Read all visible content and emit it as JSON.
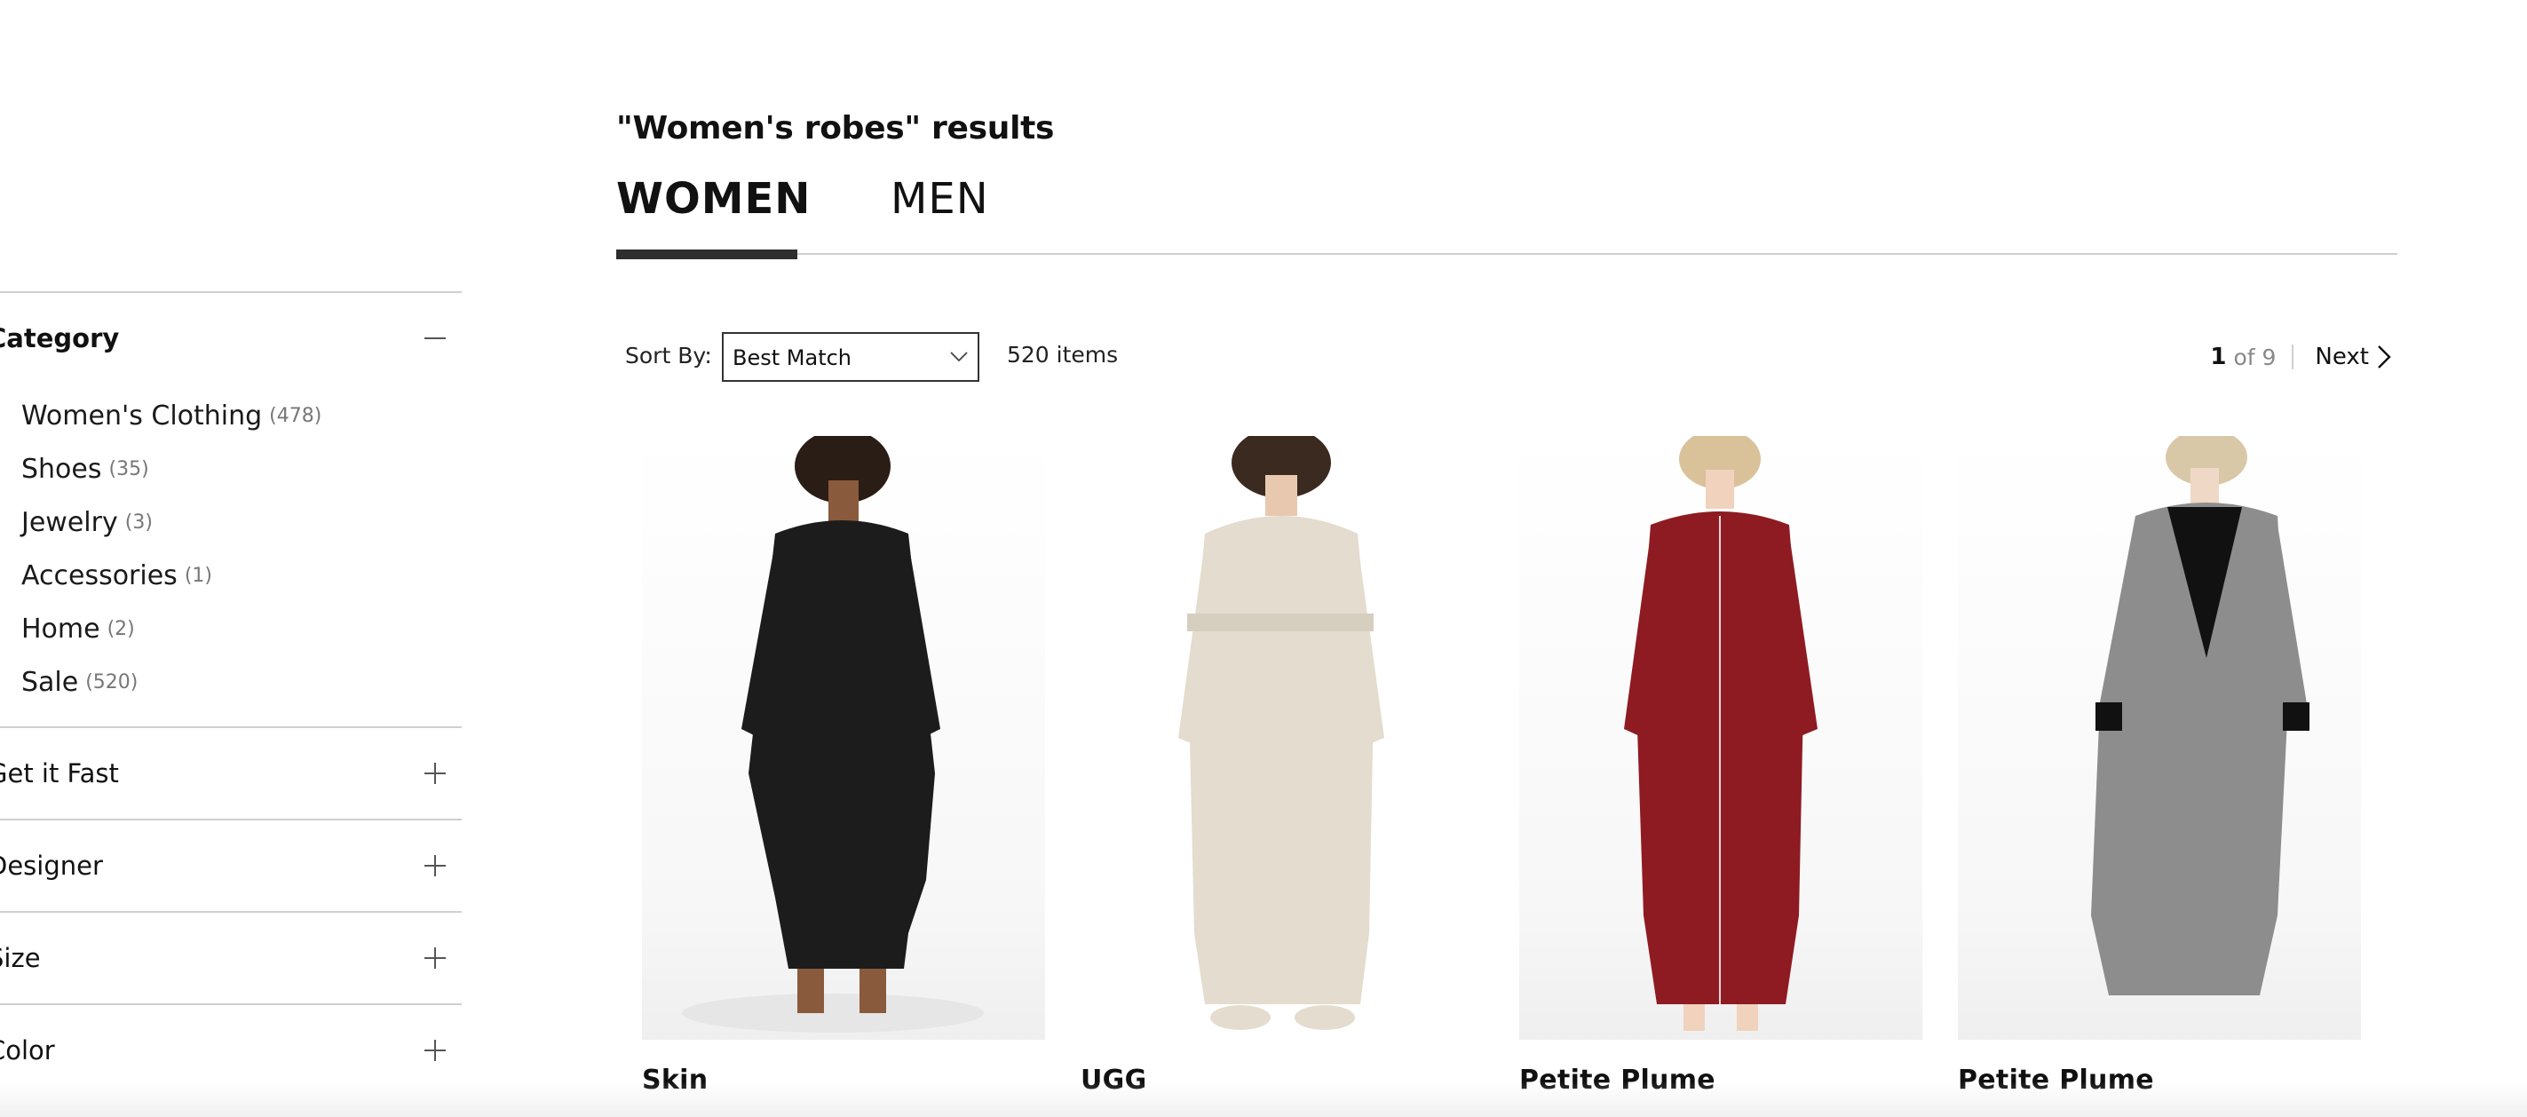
{
  "search": {
    "results_title": "\"Women's robes\" results"
  },
  "tabs": [
    {
      "label": "WOMEN",
      "active": true
    },
    {
      "label": "MEN",
      "active": false
    }
  ],
  "sort": {
    "label": "Sort By:",
    "selected": "Best Match"
  },
  "item_count": "520 items",
  "pagination": {
    "current": "1",
    "of_text": "of 9",
    "next_label": "Next"
  },
  "sidebar": {
    "category": {
      "title": "Category",
      "items": [
        {
          "label": "Women's Clothing",
          "count": "(478)"
        },
        {
          "label": "Shoes",
          "count": "(35)"
        },
        {
          "label": "Jewelry",
          "count": "(3)"
        },
        {
          "label": "Accessories",
          "count": "(1)"
        },
        {
          "label": "Home",
          "count": "(2)"
        },
        {
          "label": "Sale",
          "count": "(520)"
        }
      ]
    },
    "sections": [
      {
        "title": "Get it Fast"
      },
      {
        "title": "Designer"
      },
      {
        "title": "Size"
      },
      {
        "title": "Color"
      }
    ]
  },
  "products": [
    {
      "brand": "Skin",
      "robe_color": "#1c1c1c"
    },
    {
      "brand": "UGG",
      "robe_color": "#e3dccf"
    },
    {
      "brand": "Petite Plume",
      "robe_color": "#8e1b22"
    },
    {
      "brand": "Petite Plume",
      "robe_color": "#8d8d8d"
    }
  ]
}
